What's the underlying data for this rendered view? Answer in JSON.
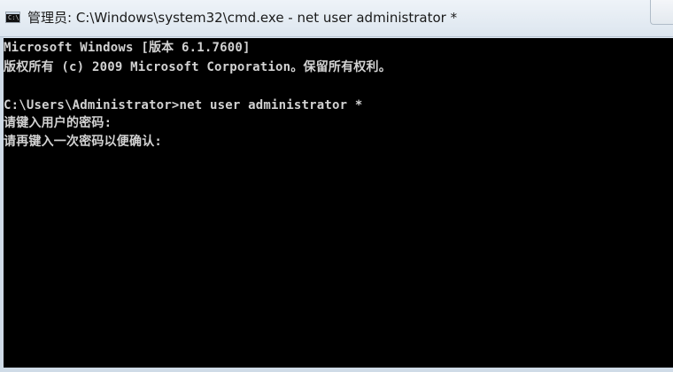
{
  "window": {
    "title": "管理员: C:\\Windows\\system32\\cmd.exe - net  user administrator *",
    "icon": "cmd-console-icon",
    "icon_label": "C:\\"
  },
  "console": {
    "lines": [
      "Microsoft Windows [版本 6.1.7600]",
      "版权所有 (c) 2009 Microsoft Corporation。保留所有权利。",
      "",
      "C:\\Users\\Administrator>net user administrator *",
      "请键入用户的密码:",
      "请再键入一次密码以便确认:"
    ]
  },
  "colors": {
    "console_background": "#000000",
    "console_text": "#d2d2d2",
    "titlebar": "#e6edf4"
  }
}
